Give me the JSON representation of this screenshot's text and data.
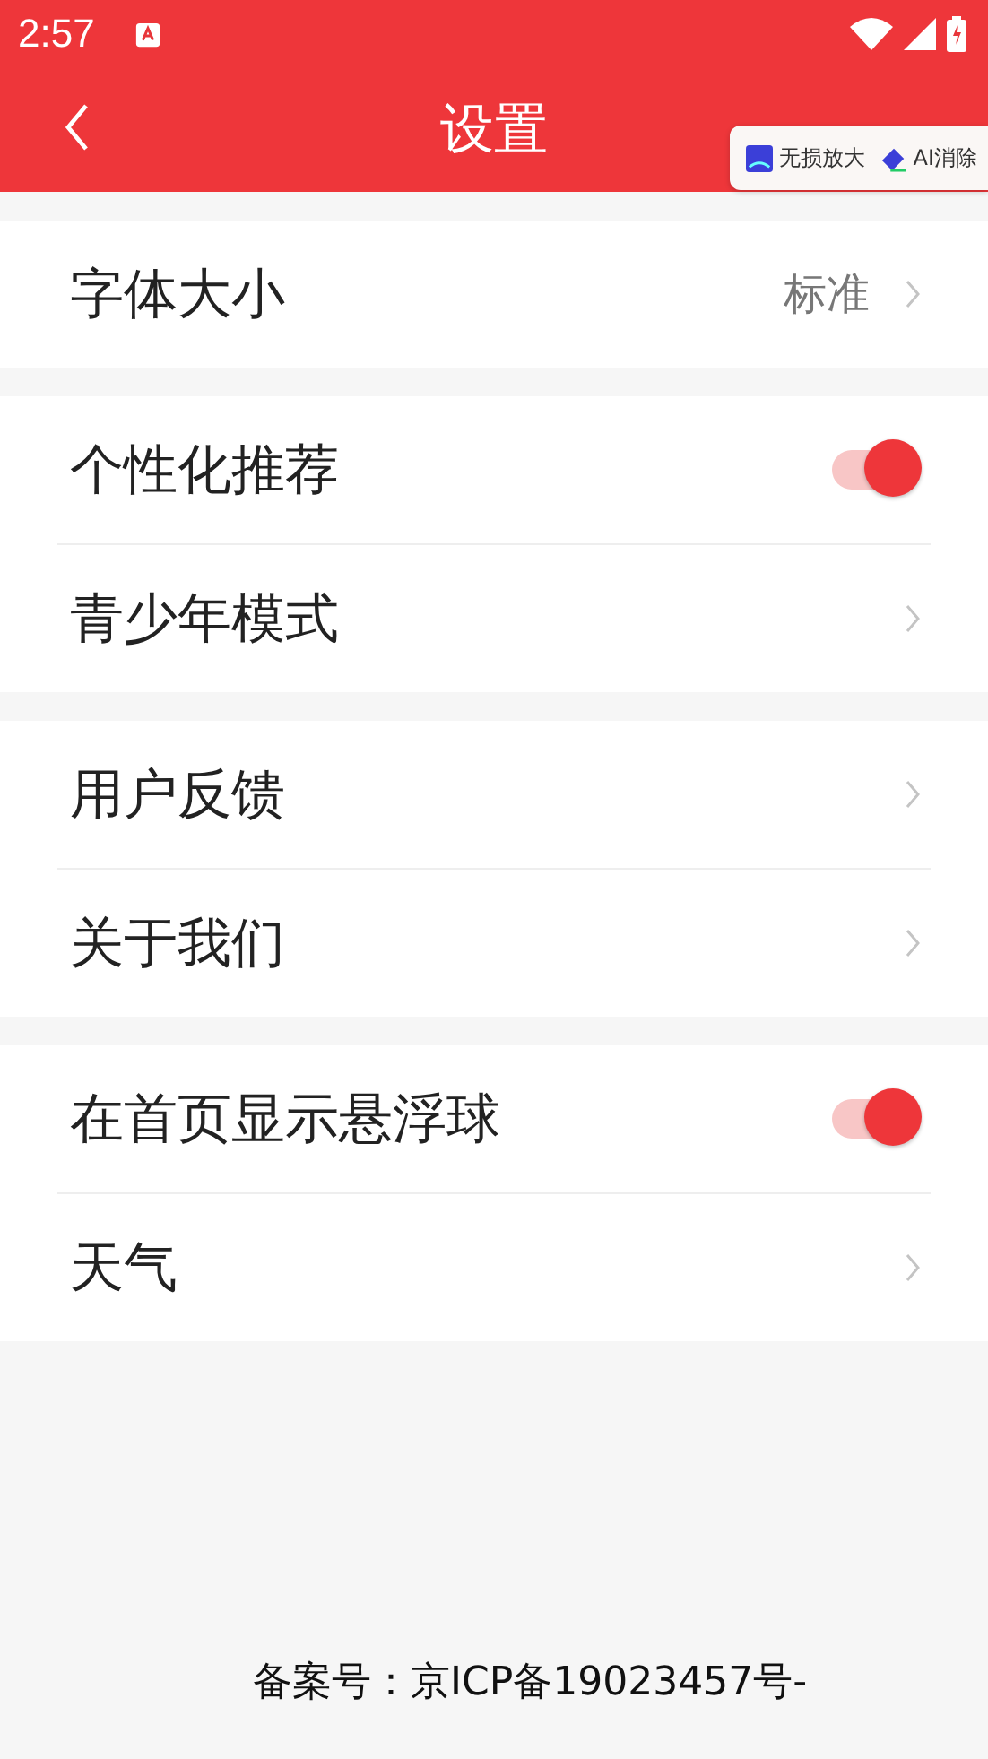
{
  "status_bar": {
    "time": "2:57"
  },
  "header": {
    "title": "设置"
  },
  "overlay_toolbar": {
    "items": [
      "无损放大",
      "AI消除"
    ]
  },
  "groups": [
    [
      {
        "label": "字体大小",
        "kind": "link",
        "value": "标准"
      }
    ],
    [
      {
        "label": "个性化推荐",
        "kind": "toggle",
        "on": true
      },
      {
        "label": "青少年模式",
        "kind": "link"
      }
    ],
    [
      {
        "label": "用户反馈",
        "kind": "link"
      },
      {
        "label": "关于我们",
        "kind": "link"
      }
    ],
    [
      {
        "label": "在首页显示悬浮球",
        "kind": "toggle",
        "on": true
      },
      {
        "label": "天气",
        "kind": "link"
      }
    ]
  ],
  "footer": {
    "text": "备案号：京ICP备19023457号-"
  }
}
